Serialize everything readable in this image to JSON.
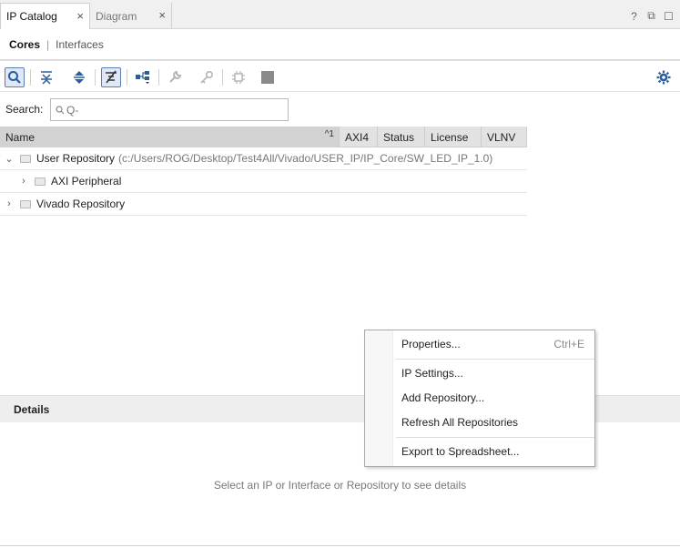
{
  "tabs": {
    "active": "IP Catalog",
    "inactive": "Diagram",
    "close_glyph": "×"
  },
  "window_controls": {
    "help": "?",
    "restore": "⧉",
    "maximize": "☐"
  },
  "subtabs": {
    "cores": "Cores",
    "separator": "|",
    "interfaces": "Interfaces"
  },
  "search": {
    "label": "Search:",
    "placeholder": "Q-"
  },
  "table": {
    "columns": [
      "Name",
      "AXI4",
      "Status",
      "License",
      "VLNV"
    ],
    "sort_indicator": "^1",
    "rows": [
      {
        "name": "User Repository",
        "path": "(c:/Users/ROG/Desktop/Test4All/Vivado/USER_IP/IP_Core/SW_LED_IP_1.0)",
        "expanded": true,
        "level": 0
      },
      {
        "name": "AXI Peripheral",
        "expanded": false,
        "level": 1
      },
      {
        "name": "Vivado Repository",
        "expanded": false,
        "level": 0
      }
    ]
  },
  "details": {
    "title": "Details",
    "empty_message": "Select an IP or Interface or Repository to see details"
  },
  "context_menu": {
    "items": [
      {
        "label": "Properties...",
        "shortcut": "Ctrl+E"
      },
      {
        "label": "IP Settings..."
      },
      {
        "label": "Add Repository..."
      },
      {
        "label": "Refresh All Repositories"
      },
      {
        "label": "Export to Spreadsheet..."
      }
    ]
  },
  "colors": {
    "selected_button_border": "#5c7fb0",
    "gear": "#2b5d9c",
    "header_bg": "#e2e2e2"
  }
}
